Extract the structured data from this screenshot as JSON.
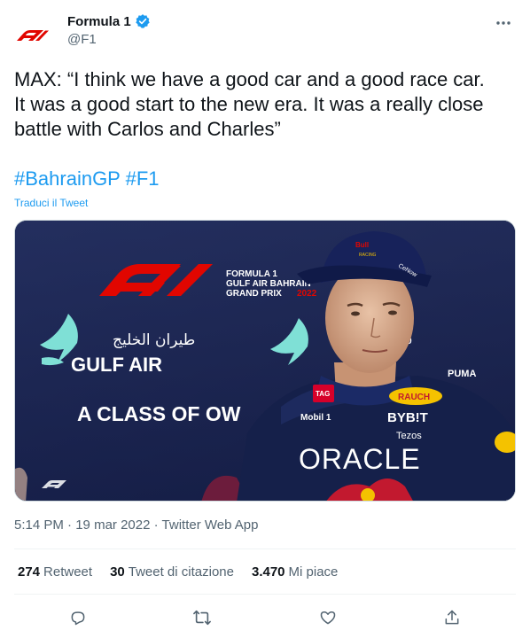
{
  "author": {
    "name": "Formula 1",
    "handle": "@F1",
    "verified": true,
    "avatar_icon": "f1-logo-icon",
    "brand_color": "#e10600"
  },
  "tweet": {
    "text": "MAX: “I think we have a good car and a good race car.\nIt was a good start to the new era. It was a really close\nbattle with Carlos and Charles”",
    "hashtags": [
      "#BahrainGP",
      "#F1"
    ],
    "translate_label": "Traduci il Tweet"
  },
  "media": {
    "board_title_lines": [
      "FORMULA 1",
      "GULF AIR BAHRAIN",
      "GRAND PRIX"
    ],
    "board_year": "2022",
    "gulf_air_arabic": "طيران الخليج",
    "gulf_air_english": "GULF AIR",
    "class_slogan": "A CLASS OF OW",
    "sponsors": {
      "rauch": "RAUCH",
      "bybit": "BYB!T",
      "tezos": "Tezos",
      "oracle": "ORACLE",
      "mobil": "Mobil 1",
      "tag": "TAG",
      "puma": "PUMA",
      "cap_brand": "Bull",
      "cap_text": "RACING"
    }
  },
  "meta": {
    "time": "5:14 PM",
    "date": "19 mar 2022",
    "app": "Twitter Web App"
  },
  "stats": [
    {
      "count": "274",
      "label": "Retweet"
    },
    {
      "count": "30",
      "label": "Tweet di citazione"
    },
    {
      "count": "3.470",
      "label": "Mi piace"
    }
  ],
  "colors": {
    "accent": "#1d9bf0",
    "text": "#0f1419",
    "secondary": "#536471"
  }
}
